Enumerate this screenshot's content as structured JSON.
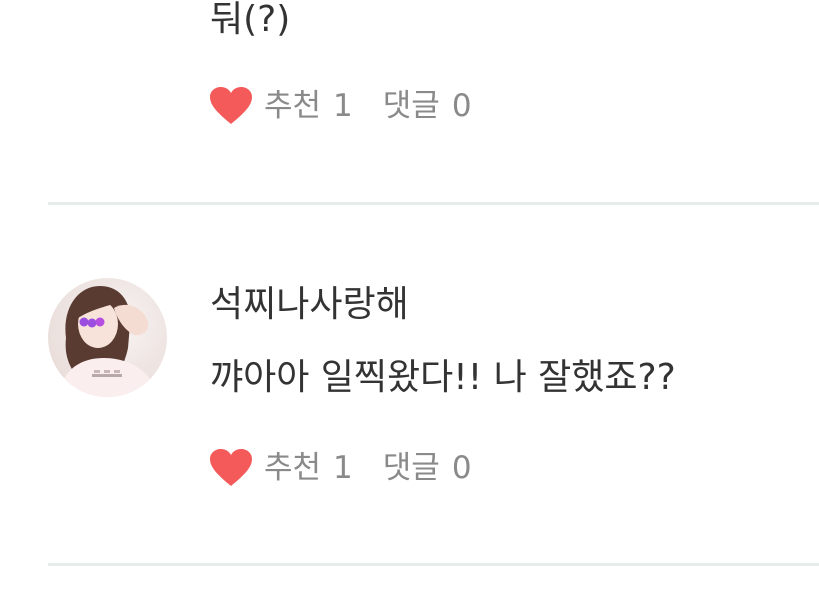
{
  "comments": [
    {
      "content": "둬(?)",
      "like_label": "추천",
      "like_count": "1",
      "reply_label": "댓글",
      "reply_count": "0"
    },
    {
      "username": "석찌나사랑해",
      "content": "꺄아아 일찍왔다!! 나 잘했죠??",
      "like_label": "추천",
      "like_count": "1",
      "reply_label": "댓글",
      "reply_count": "0"
    }
  ],
  "colors": {
    "heart": "#f45a5a",
    "meta_text": "#8a8a8a",
    "body_text": "#333333",
    "divider": "#e6ecea"
  },
  "icons": {
    "like": "heart-icon",
    "avatar": "profile-photo"
  }
}
